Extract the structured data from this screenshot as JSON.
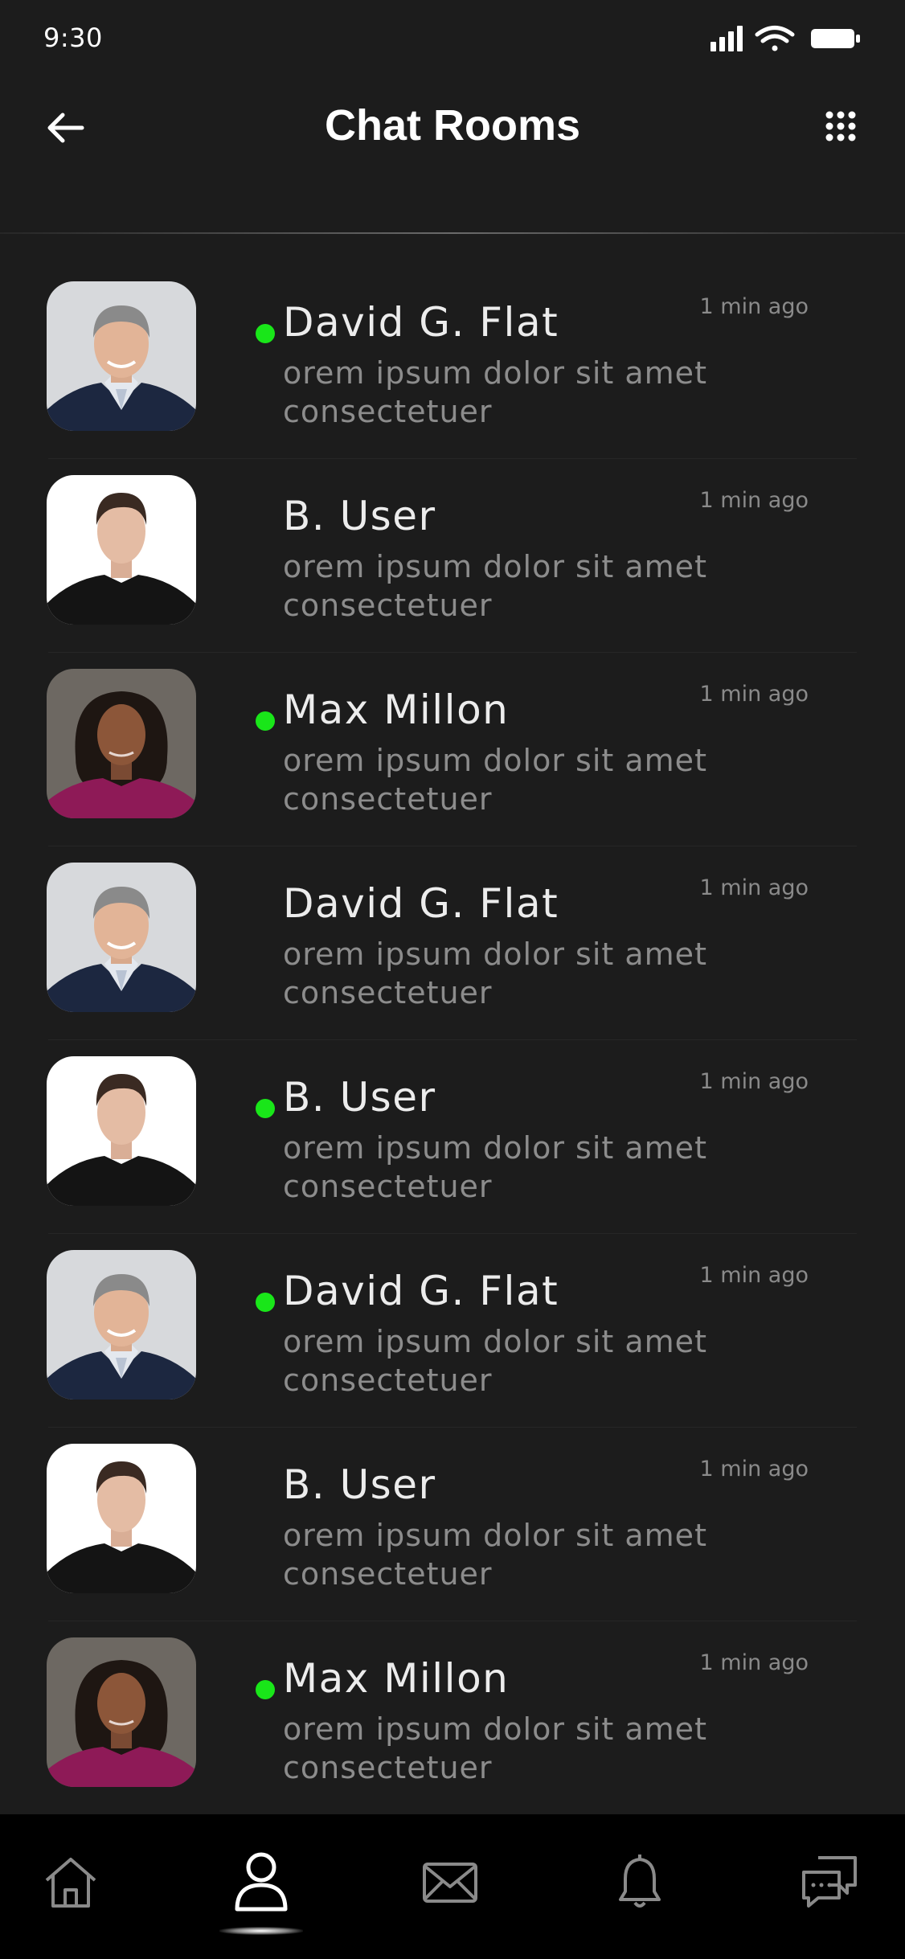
{
  "status_bar": {
    "time": "9:30",
    "icons": [
      "cellular-signal-icon",
      "wifi-icon",
      "battery-icon"
    ]
  },
  "header": {
    "title": "Chat Rooms",
    "back_icon": "arrow-left-icon",
    "menu_icon": "grid-dots-icon"
  },
  "chats": [
    {
      "name": "David G. Flat",
      "time": "1 min ago",
      "preview": "orem ipsum dolor sit amet consectetuer",
      "online": true,
      "avatar": "man-gray-hair-suit"
    },
    {
      "name": "B. User",
      "time": "1 min ago",
      "preview": "orem ipsum dolor sit amet consectetuer",
      "online": false,
      "avatar": "young-man-black-shirt"
    },
    {
      "name": "Max Millon",
      "time": "1 min ago",
      "preview": "orem ipsum dolor sit amet consectetuer",
      "online": true,
      "avatar": "woman-magenta-top"
    },
    {
      "name": "David G. Flat",
      "time": "1 min ago",
      "preview": "orem ipsum dolor sit amet consectetuer",
      "online": false,
      "avatar": "man-gray-hair-suit"
    },
    {
      "name": "B. User",
      "time": "1 min ago",
      "preview": "orem ipsum dolor sit amet consectetuer",
      "online": true,
      "avatar": "young-man-black-shirt"
    },
    {
      "name": "David G. Flat",
      "time": "1 min ago",
      "preview": "orem ipsum dolor sit amet consectetuer",
      "online": true,
      "avatar": "man-gray-hair-suit"
    },
    {
      "name": "B. User",
      "time": "1 min ago",
      "preview": "orem ipsum dolor sit amet consectetuer",
      "online": false,
      "avatar": "young-man-black-shirt"
    },
    {
      "name": "Max Millon",
      "time": "1 min ago",
      "preview": "orem ipsum dolor sit amet consectetuer",
      "online": true,
      "avatar": "woman-magenta-top"
    }
  ],
  "bottom_nav": {
    "items": [
      "home-icon",
      "profile-icon",
      "mail-icon",
      "bell-icon",
      "chat-bubbles-icon"
    ],
    "active": "profile-icon"
  },
  "colors": {
    "background": "#1c1c1c",
    "nav_background": "#000000",
    "online": "#19e619",
    "name_text": "#ececec",
    "secondary_text": "#8c8c8c"
  }
}
